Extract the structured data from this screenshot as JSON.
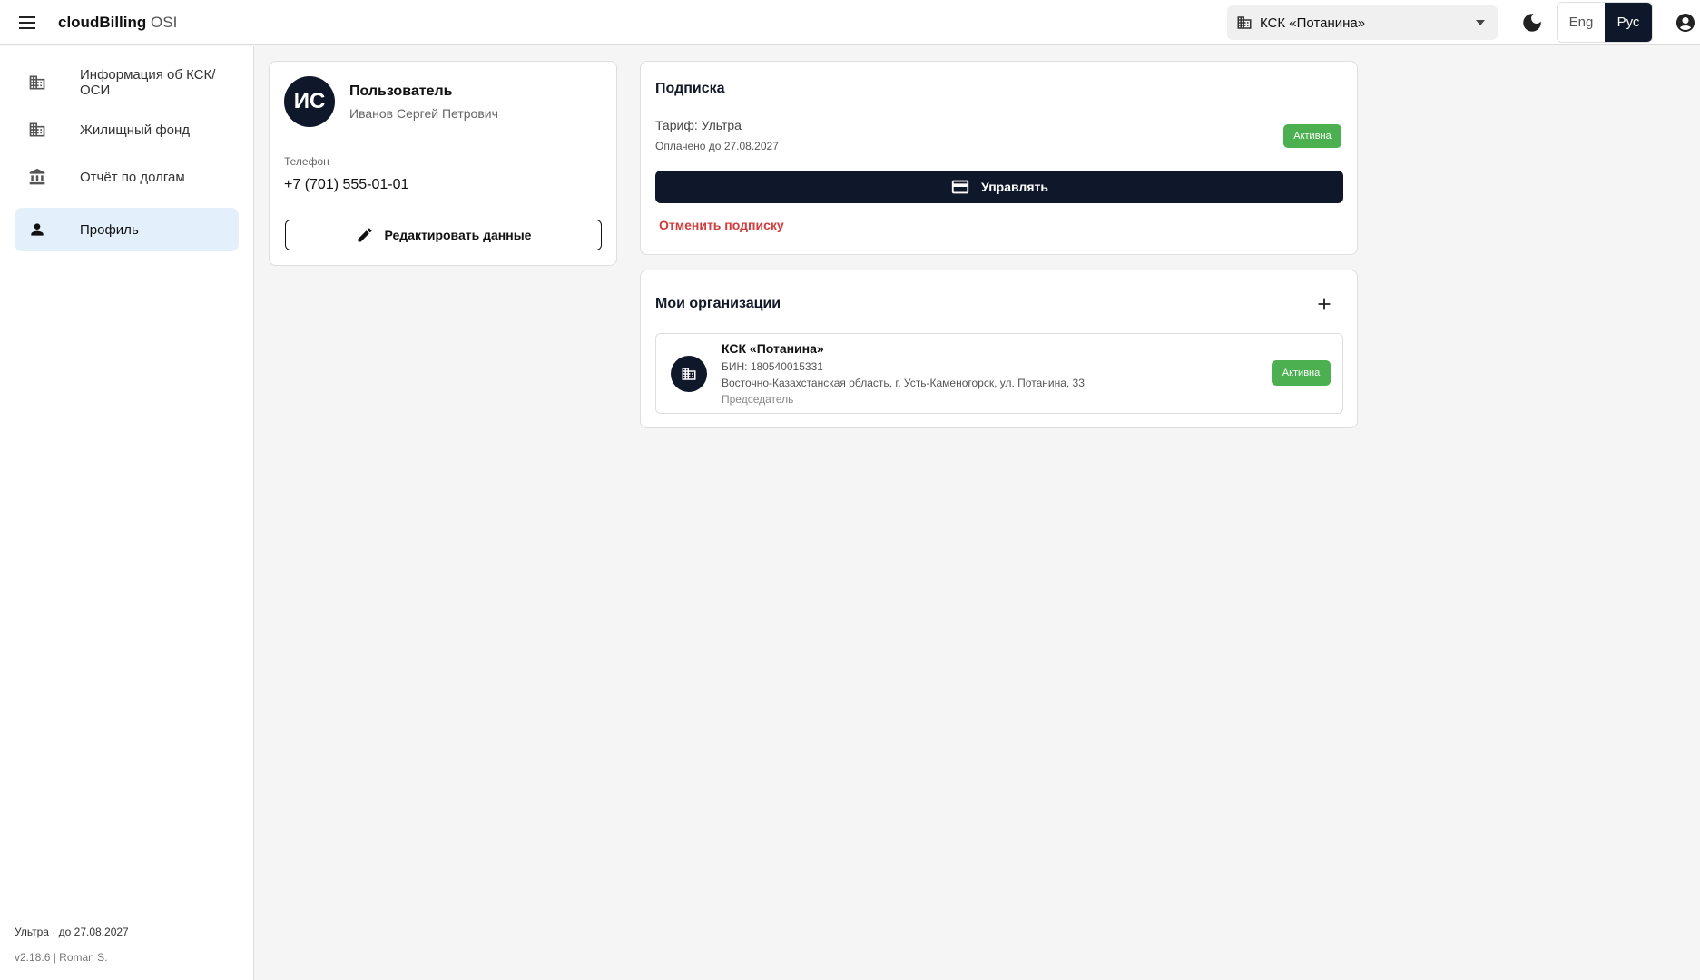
{
  "header": {
    "app_name_bold": "cloudBilling",
    "app_name_suffix": " OSI",
    "org_selector": {
      "label": "КСК «Потанина»",
      "icon": "building-icon"
    },
    "languages": {
      "eng": "Eng",
      "rus": "Рус",
      "selected": "Рус"
    }
  },
  "sidebar": {
    "items": [
      {
        "label": "Информация об КСК/ ОСИ",
        "icon": "building-icon"
      },
      {
        "label": "Жилищный фонд",
        "icon": "building-icon"
      },
      {
        "label": "Отчёт по долгам",
        "icon": "bank-icon"
      },
      {
        "label": "Профиль",
        "icon": "person-icon",
        "active": true
      }
    ],
    "footer": {
      "plan": "Ультра · до 27.08.2027",
      "version": "v2.18.6 | Roman S."
    }
  },
  "profile": {
    "initials": "ИС",
    "role": "Пользователь",
    "name": "Иванов Сергей Петрович",
    "phone_label": "Телефон",
    "phone": "+7 (701) 555-01-01",
    "edit_button": "Редактировать данные"
  },
  "subscription": {
    "title": "Подписка",
    "tariff": "Тариф: Ультра",
    "paid_until": "Оплачено до 27.08.2027",
    "status": "Активна",
    "manage_button": "Управлять",
    "cancel_link": "Отменить подписку"
  },
  "organizations": {
    "title": "Мои организации",
    "items": [
      {
        "name": "КСК «Потанина»",
        "bin": "БИН: 180540015331",
        "address": "Восточно-Казахстанская область, г. Усть-Каменогорск, ул. Потанина, 33",
        "role": "Председатель",
        "status": "Активна"
      }
    ]
  },
  "colors": {
    "primary_dark": "#0f172a",
    "active_nav_bg": "#e3f0fb",
    "status_green": "#4caf50",
    "danger_red": "#d23c3c"
  }
}
